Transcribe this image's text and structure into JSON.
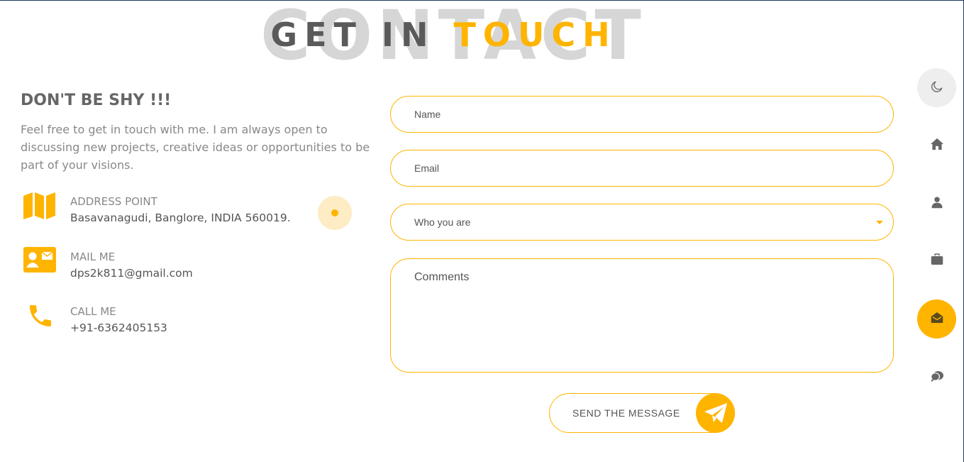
{
  "header": {
    "background_word": "CONTACT",
    "title_part1": "GET IN",
    "title_part2": "TOUCH"
  },
  "intro": {
    "heading": "DON'T BE SHY !!!",
    "text": "Feel free to get in touch with me. I am always open to discussing new projects, creative ideas or opportunities to be part of your visions."
  },
  "contact_info": [
    {
      "label": "ADDRESS POINT",
      "value": "Basavanagudi, Banglore, INDIA 560019.",
      "icon": "map-icon"
    },
    {
      "label": "MAIL ME",
      "value": "dps2k811@gmail.com",
      "icon": "contact-card-icon"
    },
    {
      "label": "CALL ME",
      "value": "+91-6362405153",
      "icon": "phone-icon"
    }
  ],
  "form": {
    "name_placeholder": "Name",
    "email_placeholder": "Email",
    "role_select": "Who you are",
    "comments_placeholder": "Comments",
    "send_label": "SEND THE MESSAGE"
  },
  "nav": {
    "items": [
      "theme-toggle",
      "home",
      "about",
      "portfolio",
      "contact",
      "blog"
    ],
    "active": "contact"
  },
  "colors": {
    "accent": "#ffb400",
    "text_dark": "#5a5a5a",
    "text_muted": "#888888",
    "bg_word": "#d6d6d6"
  }
}
